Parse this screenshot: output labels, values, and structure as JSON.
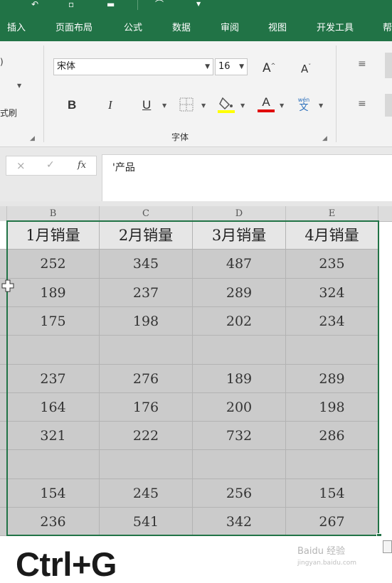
{
  "ribbon_tabs": [
    "插入",
    "页面布局",
    "公式",
    "数据",
    "审阅",
    "视图",
    "开发工具",
    "帮"
  ],
  "ribbon": {
    "font_name": "宋体",
    "font_size": "16",
    "font_group_label": "字体",
    "left_cut_label": "式刷",
    "bold_label": "B",
    "italic_label": "I",
    "underline_label": "U",
    "increase_font_label": "A",
    "decrease_font_label": "A",
    "font_color_label": "A",
    "phonetic_top": "wén",
    "phonetic_bottom": "文",
    "highlight_color": "#ffff00",
    "font_color": "#e00000"
  },
  "formula_bar": {
    "cancel_icon": "×",
    "enter_icon": "✓",
    "fx_label": "fx",
    "content": "'产品"
  },
  "columns": [
    "B",
    "C",
    "D",
    "E"
  ],
  "table": {
    "headers": [
      "1月销量",
      "2月销量",
      "3月销量",
      "4月销量"
    ],
    "rows": [
      [
        "252",
        "345",
        "487",
        "235"
      ],
      [
        "189",
        "237",
        "289",
        "324"
      ],
      [
        "175",
        "198",
        "202",
        "234"
      ],
      [
        "",
        "",
        "",
        ""
      ],
      [
        "237",
        "276",
        "189",
        "289"
      ],
      [
        "164",
        "176",
        "200",
        "198"
      ],
      [
        "321",
        "222",
        "732",
        "286"
      ],
      [
        "",
        "",
        "",
        ""
      ],
      [
        "154",
        "245",
        "256",
        "154"
      ],
      [
        "236",
        "541",
        "342",
        "267"
      ]
    ]
  },
  "shortcut_caption": "Ctrl+G",
  "watermark": {
    "main": "Baidu 经验",
    "sub": "jingyan.baidu.com"
  },
  "colors": {
    "excel_green": "#217346",
    "selection_fill": "#cbcbcb"
  }
}
